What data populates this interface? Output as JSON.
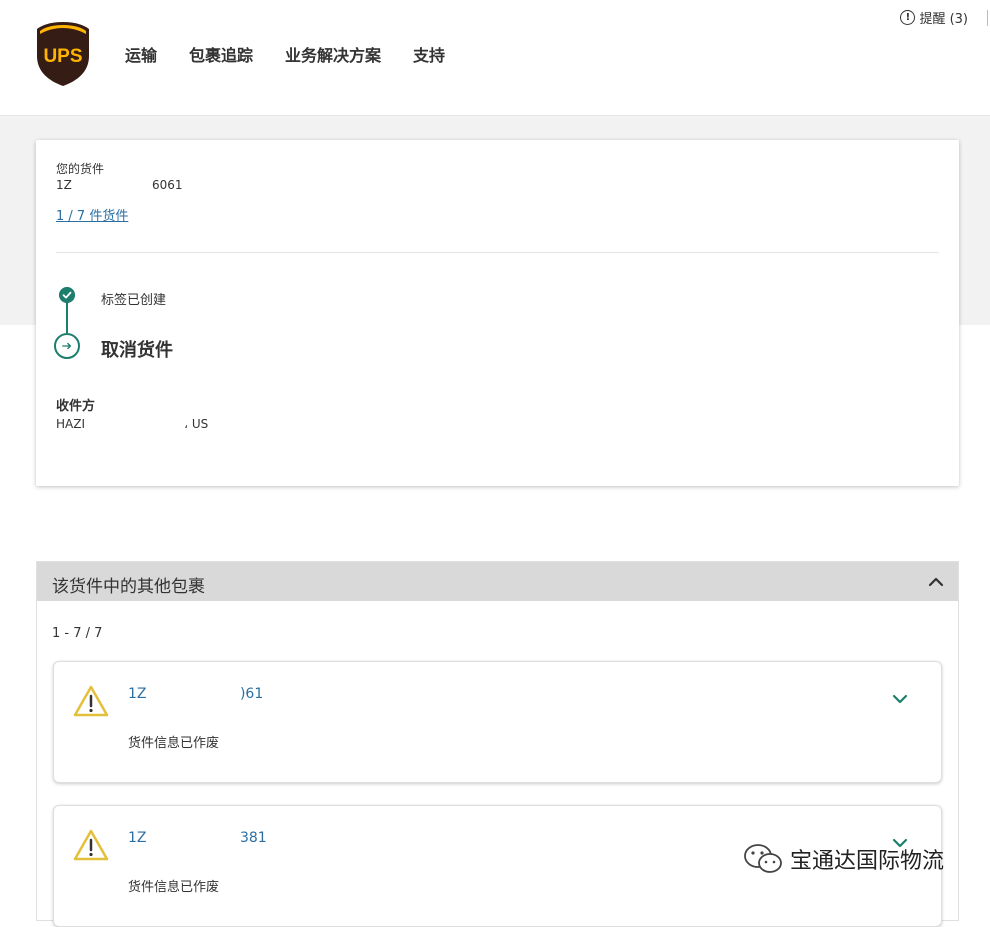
{
  "header": {
    "logo_text": "UPS",
    "nav": [
      "运输",
      "包裹追踪",
      "业务解决方案",
      "支持"
    ],
    "alerts_icon": "alert-circle-icon",
    "alerts_label": "提醒 (3)"
  },
  "shipment": {
    "label": "您的货件",
    "tracking_number": "1Z                     6061",
    "count_link": "1 / 7 件货件",
    "steps": [
      {
        "label": "标签已创建",
        "icon": "check-circle-icon"
      },
      {
        "label": "取消货件",
        "icon": "arrow-circle-icon"
      }
    ],
    "recipient_label": "收件方",
    "recipient_value": "HAZI                          ، US"
  },
  "packages": {
    "title": "该货件中的其他包裹",
    "count": "1 - 7 / 7",
    "items": [
      {
        "tracking": "1Z                     )61",
        "status": "货件信息已作废"
      },
      {
        "tracking": "1Z                     381",
        "status": "货件信息已作废"
      }
    ]
  },
  "watermark": {
    "text": "宝通达国际物流"
  },
  "colors": {
    "brand_brown": "#351c15",
    "brand_gold": "#ffb500",
    "teal": "#1d7e6e",
    "link": "#2a6fa3",
    "warning": "#e4c03a"
  }
}
